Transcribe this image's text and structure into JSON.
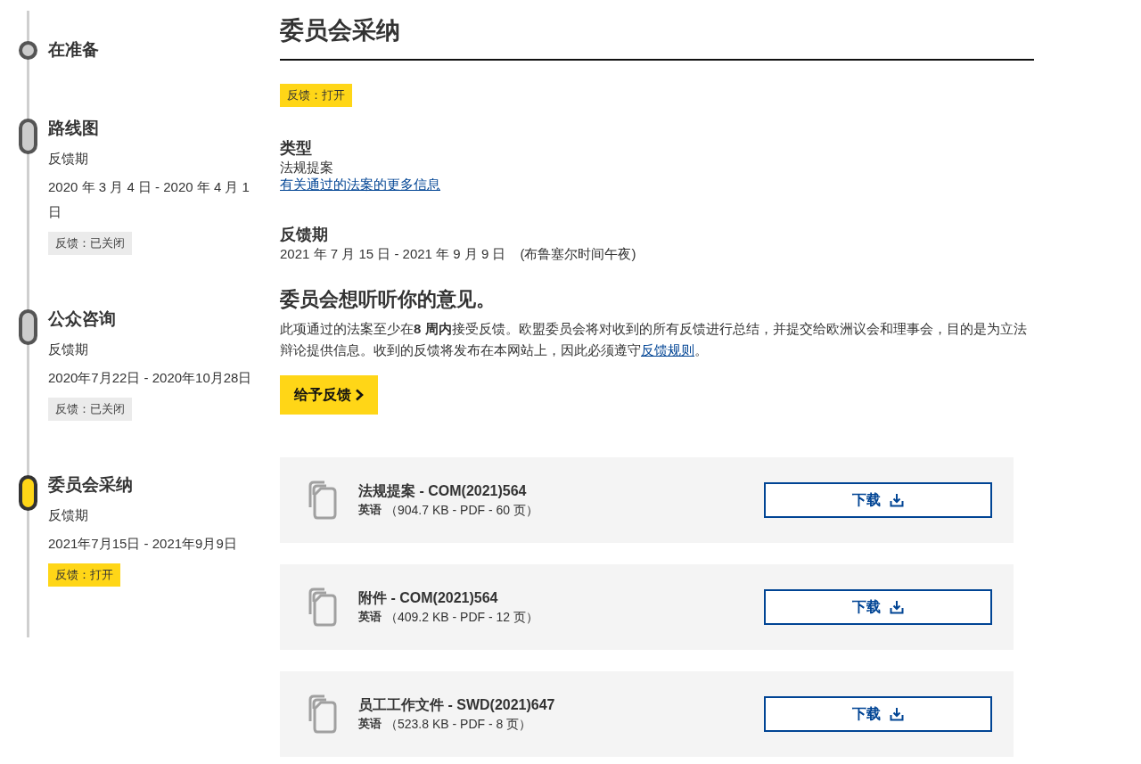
{
  "timeline": [
    {
      "title": "在准备",
      "kind": "point",
      "active": false
    },
    {
      "title": "路线图",
      "kind": "span",
      "active": false,
      "label": "反馈期",
      "dates": "2020 年 3 月 4 日 - 2020 年 4 月 1 日",
      "badge": {
        "text": "反馈：已关闭",
        "open": false
      }
    },
    {
      "title": "公众咨询",
      "kind": "span",
      "active": false,
      "label": "反馈期",
      "dates": "2020年7月22日 - 2020年10月28日",
      "badge": {
        "text": "反馈：已关闭",
        "open": false
      }
    },
    {
      "title": "委员会采纳",
      "kind": "span",
      "active": true,
      "label": "反馈期",
      "dates": "2021年7月15日 - 2021年9月9日",
      "badge": {
        "text": "反馈：打开",
        "open": true
      }
    }
  ],
  "main": {
    "title": "委员会采纳",
    "badge": {
      "text": "反馈：打开",
      "open": true
    },
    "type": {
      "heading": "类型",
      "value": "法规提案",
      "link": "有关通过的法案的更多信息"
    },
    "period": {
      "heading": "反馈期",
      "dates": "2021 年 7 月 15 日 - 2021 年 9 月 9 日",
      "note": "(布鲁塞尔时间午夜)"
    },
    "invite": {
      "heading": "委员会想听听你的意见。",
      "text": "此项通过的法案至少在**8 周内**接受反馈。欧盟委员会将对收到的所有反馈进行总结，并提交给欧洲议会和理事会，目的是为立法辩论提供信息。收到的反馈将发布在本网站上，因此必须遵守",
      "link": "反馈规则",
      "after": "。",
      "button": "给予反馈"
    },
    "documents": [
      {
        "title": "法规提案 - COM(2021)564",
        "language": "英语",
        "meta": "（904.7 KB - PDF - 60 页）",
        "button": "下载"
      },
      {
        "title": "附件 - COM(2021)564",
        "language": "英语",
        "meta": "（409.2 KB - PDF - 12 页）",
        "button": "下载"
      },
      {
        "title": "员工工作文件 - SWD(2021)647",
        "language": "英语",
        "meta": "（523.8 KB - PDF - 8 页）",
        "button": "下载"
      }
    ]
  }
}
